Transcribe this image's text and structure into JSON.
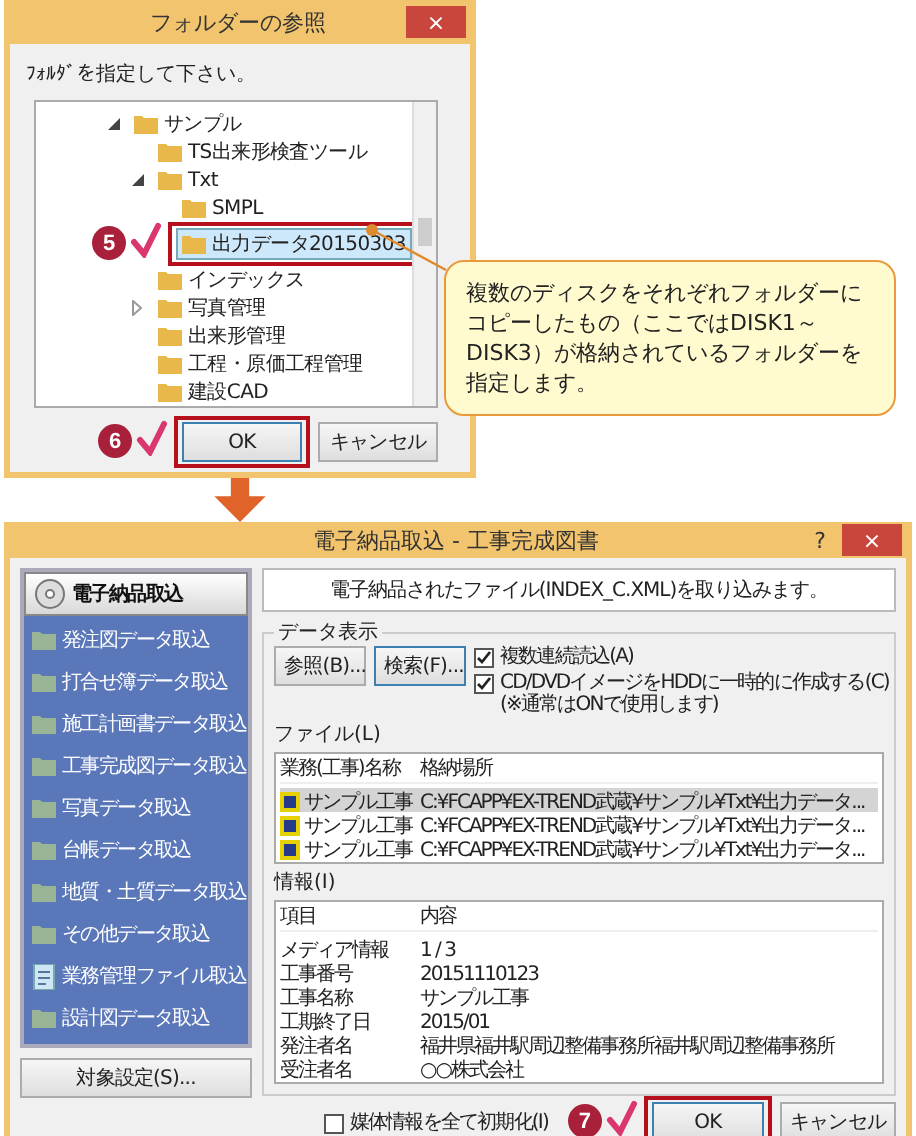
{
  "browse_dialog": {
    "title": "フォルダーの参照",
    "close": "×",
    "prompt": "ﾌｫﾙﾀﾞを指定して下さい。",
    "tree": [
      {
        "label": "サンプル",
        "expanded": true,
        "selected": false,
        "children": [
          {
            "label": "TS出来形検査ツール",
            "selected": false
          },
          {
            "label": "Txt",
            "expanded": true,
            "selected": false,
            "children": [
              {
                "label": "SMPL",
                "selected": false
              },
              {
                "label": "出力データ20150303",
                "selected": true,
                "step": "5"
              }
            ]
          },
          {
            "label": "インデックス",
            "selected": false
          },
          {
            "label": "写真管理",
            "expanded": false,
            "selected": false
          },
          {
            "label": "出来形管理",
            "selected": false
          },
          {
            "label": "工程・原価工程管理",
            "selected": false
          },
          {
            "label": "建設CAD",
            "selected": false
          }
        ]
      }
    ],
    "buttons": [
      {
        "label": "OK",
        "kind": "default",
        "step": "6"
      },
      {
        "label": "キャンセル",
        "kind": "normal"
      }
    ]
  },
  "callout": {
    "text": "複数のディスクをそれぞれフォルダーにコピーしたもの（ここではDISK1～DISK3）が格納されているフォルダーを指定します。"
  },
  "import_dialog": {
    "title": "電子納品取込 - 工事完成図書",
    "help": "?",
    "close": "×",
    "sidebar": {
      "items": [
        {
          "label": "電子納品取込",
          "kind": "disc",
          "selected": true
        },
        {
          "label": "発注図データ取込",
          "kind": "folder",
          "selected": false
        },
        {
          "label": "打合せ簿データ取込",
          "kind": "folder",
          "selected": false
        },
        {
          "label": "施工計画書データ取込",
          "kind": "folder",
          "selected": false
        },
        {
          "label": "工事完成図データ取込",
          "kind": "folder",
          "selected": false
        },
        {
          "label": "写真データ取込",
          "kind": "folder",
          "selected": false
        },
        {
          "label": "台帳データ取込",
          "kind": "folder",
          "selected": false
        },
        {
          "label": "地質・土質データ取込",
          "kind": "folder",
          "selected": false
        },
        {
          "label": "その他データ取込",
          "kind": "folder",
          "selected": false
        },
        {
          "label": "業務管理ファイル取込",
          "kind": "document",
          "selected": false
        },
        {
          "label": "設計図データ取込",
          "kind": "folder",
          "selected": false
        }
      ],
      "button": "対象設定(S)..."
    },
    "message": "電子納品されたファイル(INDEX_C.XML)を取り込みます。",
    "group_title": "データ表示",
    "buttons": [
      {
        "label": "参照(B)...",
        "focused": false
      },
      {
        "label": "検索(F)...",
        "focused": true
      }
    ],
    "options": [
      {
        "label": "複数連続読込(A)",
        "checked": true
      },
      {
        "label": "CD/DVDイメージをHDDに一時的に作成する(C)",
        "note": "(※通常はONで使用します)",
        "checked": true
      }
    ],
    "files": {
      "label": "ファイル(L)",
      "columns": [
        "業務(工事)名称",
        "格納場所"
      ],
      "rows": [
        {
          "name": "サンプル工事",
          "path": "C:¥FCAPP¥EX-TREND武蔵¥サンプル¥Txt¥出力データ...",
          "selected": true
        },
        {
          "name": "サンプル工事",
          "path": "C:¥FCAPP¥EX-TREND武蔵¥サンプル¥Txt¥出力データ...",
          "selected": false
        },
        {
          "name": "サンプル工事",
          "path": "C:¥FCAPP¥EX-TREND武蔵¥サンプル¥Txt¥出力データ...",
          "selected": false
        }
      ]
    },
    "info": {
      "label": "情報(I)",
      "columns": [
        "項目",
        "内容"
      ],
      "rows": [
        {
          "item": "メディア情報",
          "value": "1 / 3"
        },
        {
          "item": "工事番号",
          "value": "20151110123"
        },
        {
          "item": "工事名称",
          "value": "サンプル工事"
        },
        {
          "item": "工期終了日",
          "value": "2015/01"
        },
        {
          "item": "発注者名",
          "value": "福井県福井駅周辺整備事務所福井駅周辺整備事務所"
        },
        {
          "item": "受注者名",
          "value": "○○株式会社"
        }
      ]
    },
    "reset_option": {
      "label": "媒体情報を全て初期化(I)",
      "checked": false
    },
    "footer_buttons": [
      {
        "label": "OK",
        "kind": "default",
        "step": "7"
      },
      {
        "label": "キャンセル",
        "kind": "normal"
      }
    ]
  }
}
